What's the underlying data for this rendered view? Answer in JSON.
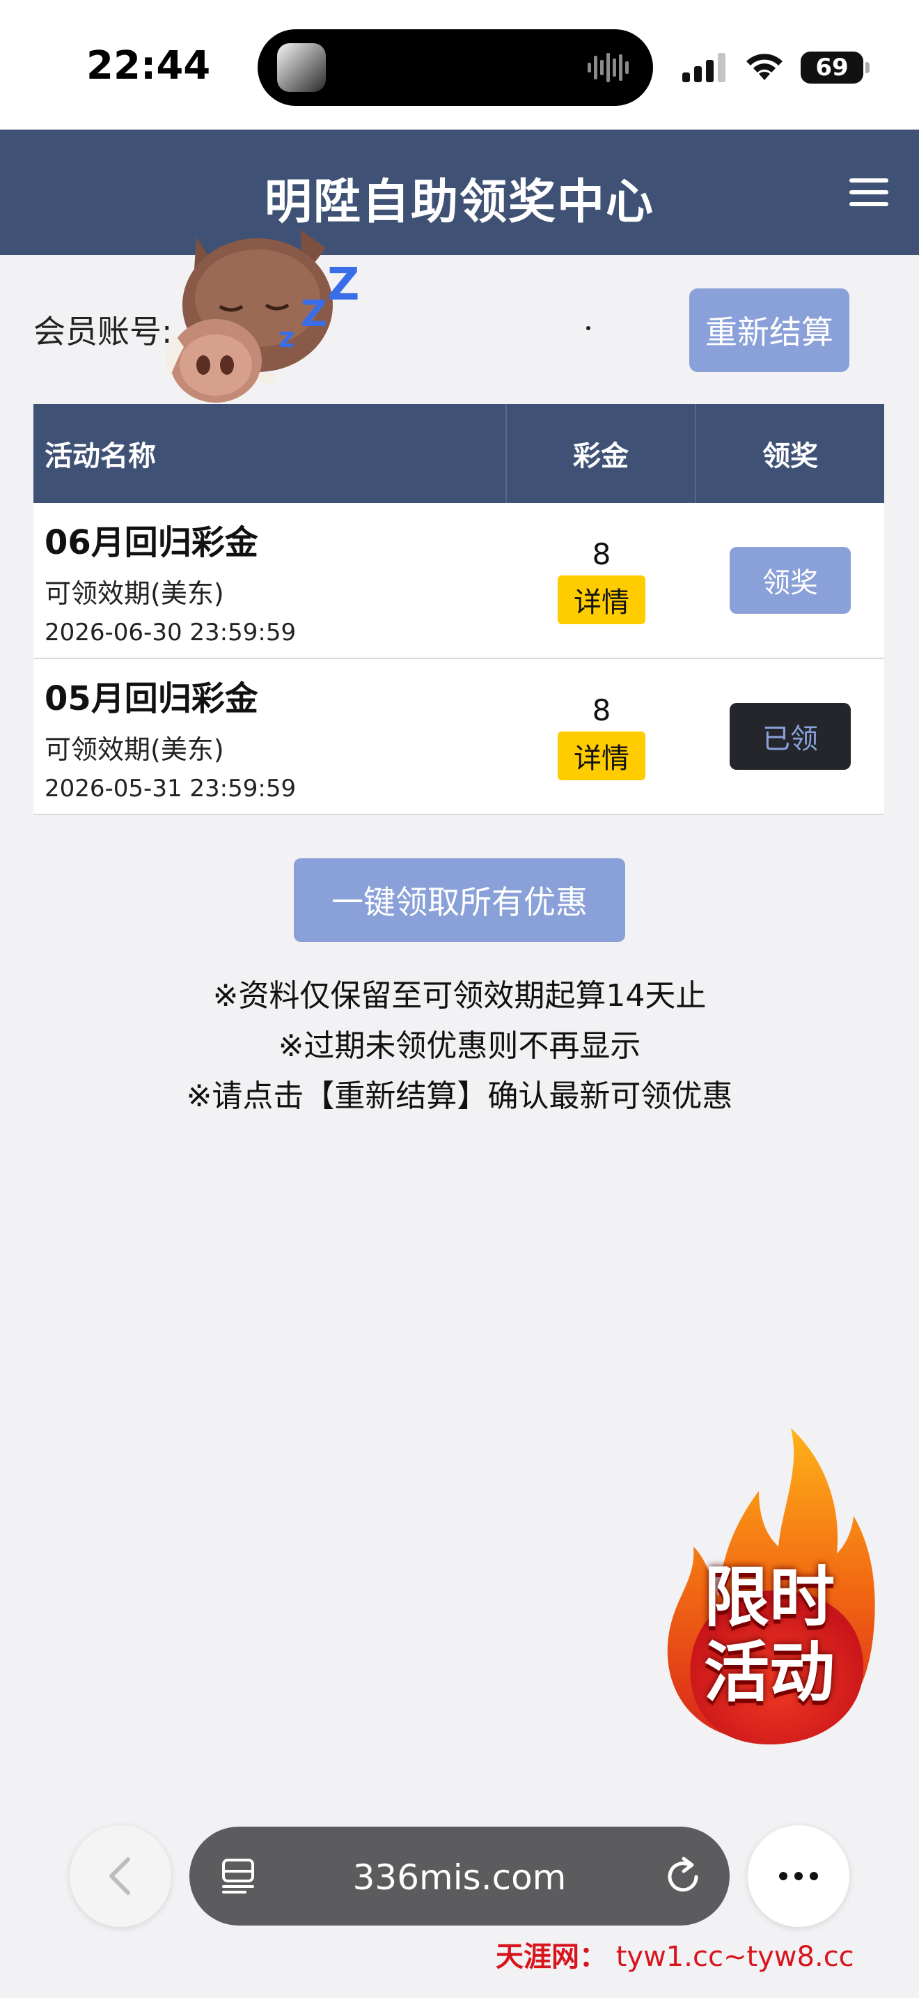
{
  "status_bar": {
    "time": "22:44",
    "battery": "69"
  },
  "header": {
    "title": "明陞自助领奖中心"
  },
  "member": {
    "label": "会员账号:",
    "recalc_label": "重新结算"
  },
  "table": {
    "headers": {
      "name": "活动名称",
      "bonus": "彩金",
      "claim": "领奖"
    },
    "rows": [
      {
        "title": "06月回归彩金",
        "validity_label": "可领效期(美东)",
        "deadline": "2026-06-30 23:59:59",
        "bonus": "8",
        "detail_label": "详情",
        "claim_label": "领奖",
        "claim_state": "available"
      },
      {
        "title": "05月回归彩金",
        "validity_label": "可领效期(美东)",
        "deadline": "2026-05-31 23:59:59",
        "bonus": "8",
        "detail_label": "详情",
        "claim_label": "已领",
        "claim_state": "claimed"
      }
    ]
  },
  "claim_all_label": "一键领取所有优惠",
  "notes": [
    "※资料仅保留至可领效期起算14天止",
    "※过期未领优惠则不再显示",
    "※请点击【重新结算】确认最新可领优惠"
  ],
  "promo": {
    "line1": "限时",
    "line2": "活动"
  },
  "browser": {
    "url": "336mis.com"
  },
  "watermark": {
    "brand": "天涯网：",
    "url": "tyw1.cc~tyw8.cc"
  },
  "icons": {
    "back": "chevron-left-icon",
    "tabs": "tabs-icon",
    "reload": "reload-icon",
    "more": "more-icon",
    "menu": "hamburger-menu-icon"
  },
  "colors": {
    "header": "#3f5275",
    "button": "#8aa0d8",
    "detail": "#ffcc00",
    "claimed": "#24262b"
  }
}
